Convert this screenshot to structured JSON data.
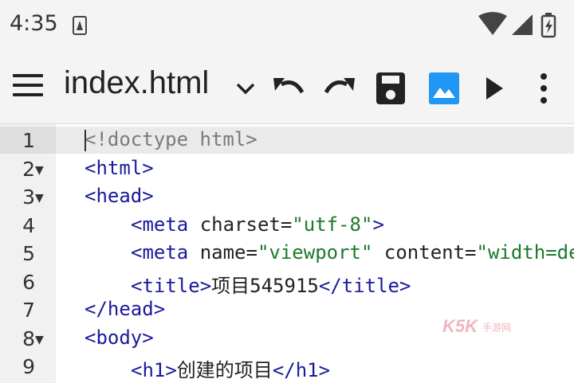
{
  "status_bar": {
    "time": "4:35",
    "notification_icon": "a-notification-icon",
    "wifi_icon": "wifi-icon",
    "signal_icon": "signal-icon",
    "battery_icon": "battery-icon"
  },
  "toolbar": {
    "menu_icon": "hamburger-menu-icon",
    "file_name": "index.html",
    "dropdown_icon": "chevron-down-icon",
    "undo_icon": "undo-icon",
    "redo_icon": "redo-icon",
    "save_icon": "save-icon",
    "image_icon": "image-icon",
    "run_icon": "play-icon",
    "more_icon": "more-vertical-icon",
    "accent_color": "#2196f3"
  },
  "editor": {
    "current_line": 1,
    "lines": [
      {
        "num": "1",
        "fold": false,
        "indent": 0,
        "parts": [
          {
            "t": "<!doctype html>",
            "c": "doctype"
          }
        ]
      },
      {
        "num": "2",
        "fold": true,
        "indent": 0,
        "parts": [
          {
            "t": "<html>",
            "c": "tag"
          }
        ]
      },
      {
        "num": "3",
        "fold": true,
        "indent": 0,
        "parts": [
          {
            "t": "<head>",
            "c": "tag"
          }
        ]
      },
      {
        "num": "4",
        "fold": false,
        "indent": 1,
        "parts": [
          {
            "t": "<meta",
            "c": "tag"
          },
          {
            "t": " charset=",
            "c": "attr"
          },
          {
            "t": "\"utf-8\"",
            "c": "val"
          },
          {
            "t": ">",
            "c": "tag"
          }
        ]
      },
      {
        "num": "5",
        "fold": false,
        "indent": 1,
        "parts": [
          {
            "t": "<meta",
            "c": "tag"
          },
          {
            "t": " name=",
            "c": "attr"
          },
          {
            "t": "\"viewport\"",
            "c": "val"
          },
          {
            "t": " content=",
            "c": "attr"
          },
          {
            "t": "\"width=de",
            "c": "val"
          }
        ]
      },
      {
        "num": "6",
        "fold": false,
        "indent": 1,
        "parts": [
          {
            "t": "<title>",
            "c": "tag"
          },
          {
            "t": "项目545915",
            "c": "txt"
          },
          {
            "t": "</title>",
            "c": "tag"
          }
        ]
      },
      {
        "num": "7",
        "fold": false,
        "indent": 0,
        "parts": [
          {
            "t": "</head>",
            "c": "tag"
          }
        ]
      },
      {
        "num": "8",
        "fold": true,
        "indent": 0,
        "parts": [
          {
            "t": "<body>",
            "c": "tag"
          }
        ]
      },
      {
        "num": "9",
        "fold": false,
        "indent": 1,
        "parts": [
          {
            "t": "<h1>",
            "c": "tag"
          },
          {
            "t": "创建的项目",
            "c": "txt"
          },
          {
            "t": "</h1>",
            "c": "tag"
          }
        ]
      }
    ]
  },
  "watermark": {
    "brand": "K5K",
    "sub": "手游网"
  }
}
